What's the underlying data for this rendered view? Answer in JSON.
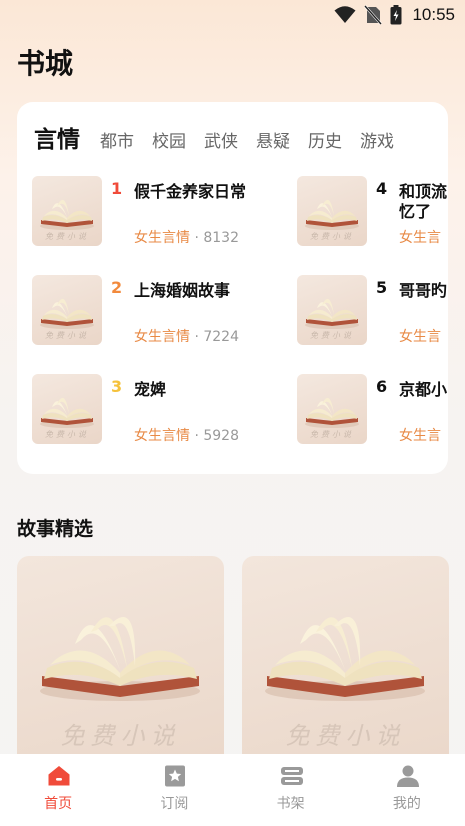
{
  "status_bar": {
    "time": "10:55"
  },
  "page_title": "书城",
  "category_tabs": [
    {
      "label": "言情",
      "active": true
    },
    {
      "label": "都市",
      "active": false
    },
    {
      "label": "校园",
      "active": false
    },
    {
      "label": "武侠",
      "active": false
    },
    {
      "label": "悬疑",
      "active": false
    },
    {
      "label": "历史",
      "active": false
    },
    {
      "label": "游戏",
      "active": false
    }
  ],
  "ranking": [
    {
      "rank": "1",
      "title": "假千金养家日常",
      "category": "女生言情",
      "separator": " · ",
      "count": "8132",
      "rank_color": "#f04b3a"
    },
    {
      "rank": "2",
      "title": "上海婚姻故事",
      "category": "女生言情",
      "separator": " · ",
      "count": "7224",
      "rank_color": "#f28a3c"
    },
    {
      "rank": "3",
      "title": "宠婢",
      "category": "女生言情",
      "separator": " · ",
      "count": "5928",
      "rank_color": "#f5c23c"
    },
    {
      "rank": "4",
      "title": "和顶流",
      "title_line2": "忆了",
      "category": "女生言",
      "rank_color": "#111111"
    },
    {
      "rank": "5",
      "title": "哥哥旳",
      "category": "女生言",
      "rank_color": "#111111"
    },
    {
      "rank": "6",
      "title": "京都小",
      "category": "女生言",
      "rank_color": "#111111"
    }
  ],
  "cover_brand": "免费小说",
  "story_section": {
    "title": "故事精选",
    "cards_brand": "免费小说"
  },
  "bottom_nav": [
    {
      "label": "首页",
      "icon": "home-icon",
      "active": true
    },
    {
      "label": "订阅",
      "icon": "star-bookmark-icon",
      "active": false
    },
    {
      "label": "书架",
      "icon": "bookshelf-icon",
      "active": false
    },
    {
      "label": "我的",
      "icon": "user-icon",
      "active": false
    }
  ],
  "colors": {
    "accent": "#f04b3a",
    "category": "#e88a46",
    "muted": "#999999"
  }
}
